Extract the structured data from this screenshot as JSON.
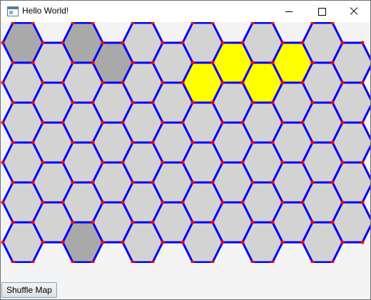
{
  "window": {
    "title": "Hello World!"
  },
  "toolbar": {
    "shuffle_label": "Shuffle Map"
  },
  "board": {
    "colors": {
      "L": "#d3d3d3",
      "G": "#a9a9a9",
      "B": "#000000",
      "Y": "#ffff00"
    },
    "edge_color": "#0000ff",
    "vertex_color": "#ff0000",
    "rows": [
      [
        "G",
        "L",
        "G",
        "L",
        "L",
        "L",
        "L",
        "L",
        "L",
        "L",
        "L",
        "L"
      ],
      [
        "L",
        "L",
        "G",
        "G",
        "L",
        "L",
        "Y",
        "Y",
        "L",
        "Y",
        "L",
        "L"
      ],
      [
        "L",
        "L",
        "L",
        "L",
        "L",
        "L",
        "Y",
        "B",
        "Y",
        "B",
        "L",
        "L"
      ],
      [
        "B",
        "L",
        "B",
        "L",
        "L",
        "L",
        "Y",
        "L",
        "B",
        "L",
        "L",
        "L"
      ],
      [
        "L",
        "G",
        "L",
        "G",
        "L",
        "L",
        "L",
        "L",
        "L",
        "L",
        "L",
        "L"
      ],
      [
        "L",
        "L",
        "L",
        "L",
        "L",
        "L",
        "Y",
        "L",
        "L",
        "L",
        "B",
        "L"
      ],
      [
        "L",
        "G",
        "L",
        "G",
        "L",
        "L",
        "L",
        "B",
        "L",
        "L",
        "L",
        "L"
      ],
      [
        "B",
        "L",
        "L",
        "L",
        "L",
        "L",
        "Y",
        "L",
        "L",
        "L",
        "L",
        "L"
      ],
      [
        "L",
        "G",
        "L",
        "L",
        "L",
        "B",
        "L",
        "L",
        "L",
        "B",
        "L",
        "L"
      ],
      [
        "L",
        "L",
        "L",
        "L",
        "G",
        "L",
        "L",
        "L",
        "G",
        "L",
        "B",
        "L"
      ],
      [
        "L",
        "L",
        "G",
        "L",
        "L",
        "L",
        "L",
        "L",
        "L",
        "L",
        "L",
        "L"
      ]
    ]
  }
}
